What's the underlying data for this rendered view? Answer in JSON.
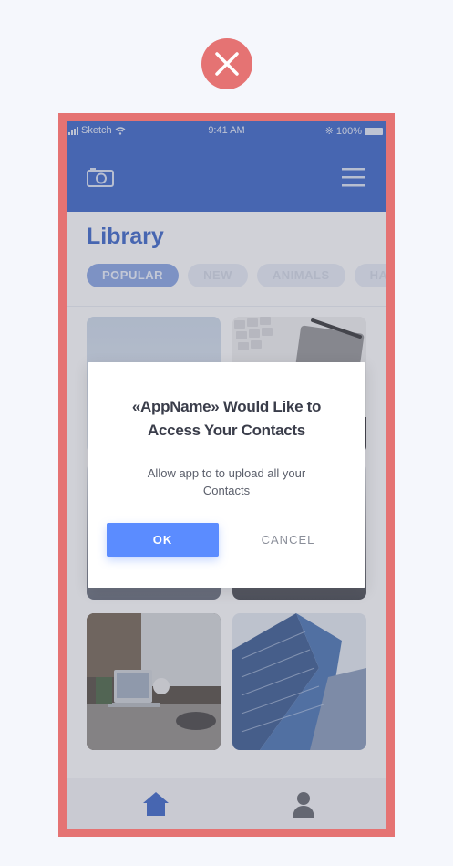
{
  "status_bar": {
    "carrier": "Sketch",
    "time": "9:41 AM",
    "battery": "100%"
  },
  "app_bar": {
    "camera_icon": "camera-icon",
    "menu_icon": "hamburger-menu-icon"
  },
  "library": {
    "title": "Library",
    "chips": [
      {
        "label": "POPULAR",
        "active": true
      },
      {
        "label": "NEW",
        "active": false
      },
      {
        "label": "ANIMALS",
        "active": false
      },
      {
        "label": "HA",
        "active": false
      }
    ]
  },
  "gallery": {
    "photos": [
      "sky-photo",
      "keyboard-desk-photo",
      "photo-3",
      "photo-4",
      "laptop-desk-photo",
      "skyscraper-photo"
    ]
  },
  "tab_bar": {
    "home_icon": "home-icon",
    "profile_icon": "person-icon"
  },
  "dialog": {
    "title": "«AppName» Would Like to Access Your Contacts",
    "message": "Allow app to to upload all your Contacts",
    "ok_label": "OK",
    "cancel_label": "CANCEL"
  },
  "colors": {
    "accent": "#2f5bc4",
    "button": "#5b8cff",
    "frame": "#e57373"
  }
}
